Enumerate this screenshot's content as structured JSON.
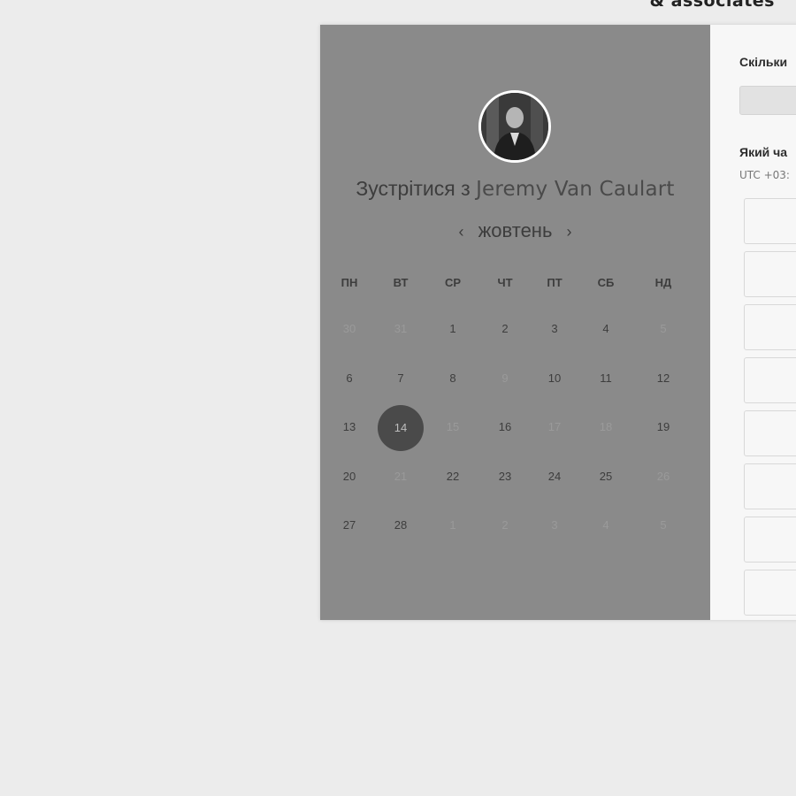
{
  "brand": {
    "tagline": "& associates"
  },
  "calendar": {
    "title_prefix": "Зустрітися з",
    "host_name": "Jeremy Van Caulart",
    "month": "жовтень",
    "prev_label": "‹",
    "next_label": "›",
    "weekdays": [
      "ПН",
      "ВТ",
      "СР",
      "ЧТ",
      "ПТ",
      "СБ",
      "НД"
    ],
    "weeks": [
      [
        {
          "d": "30",
          "m": true
        },
        {
          "d": "31",
          "m": true
        },
        {
          "d": "1"
        },
        {
          "d": "2"
        },
        {
          "d": "3"
        },
        {
          "d": "4"
        },
        {
          "d": "5",
          "m": true
        }
      ],
      [
        {
          "d": "6"
        },
        {
          "d": "7"
        },
        {
          "d": "8"
        },
        {
          "d": "9",
          "m": true
        },
        {
          "d": "10"
        },
        {
          "d": "11"
        },
        {
          "d": "12"
        }
      ],
      [
        {
          "d": "13"
        },
        {
          "d": "14",
          "sel": true
        },
        {
          "d": "15",
          "m": true
        },
        {
          "d": "16"
        },
        {
          "d": "17",
          "m": true
        },
        {
          "d": "18",
          "m": true
        },
        {
          "d": "19"
        }
      ],
      [
        {
          "d": "20"
        },
        {
          "d": "21",
          "m": true
        },
        {
          "d": "22"
        },
        {
          "d": "23"
        },
        {
          "d": "24"
        },
        {
          "d": "25"
        },
        {
          "d": "26",
          "m": true
        }
      ],
      [
        {
          "d": "27"
        },
        {
          "d": "28"
        },
        {
          "d": "1",
          "m": true
        },
        {
          "d": "2",
          "m": true
        },
        {
          "d": "3",
          "m": true
        },
        {
          "d": "4",
          "m": true
        },
        {
          "d": "5",
          "m": true
        }
      ]
    ]
  },
  "booking": {
    "duration_label": "Скільки",
    "time_label": "Який ча",
    "timezone": "UTC +03:"
  }
}
